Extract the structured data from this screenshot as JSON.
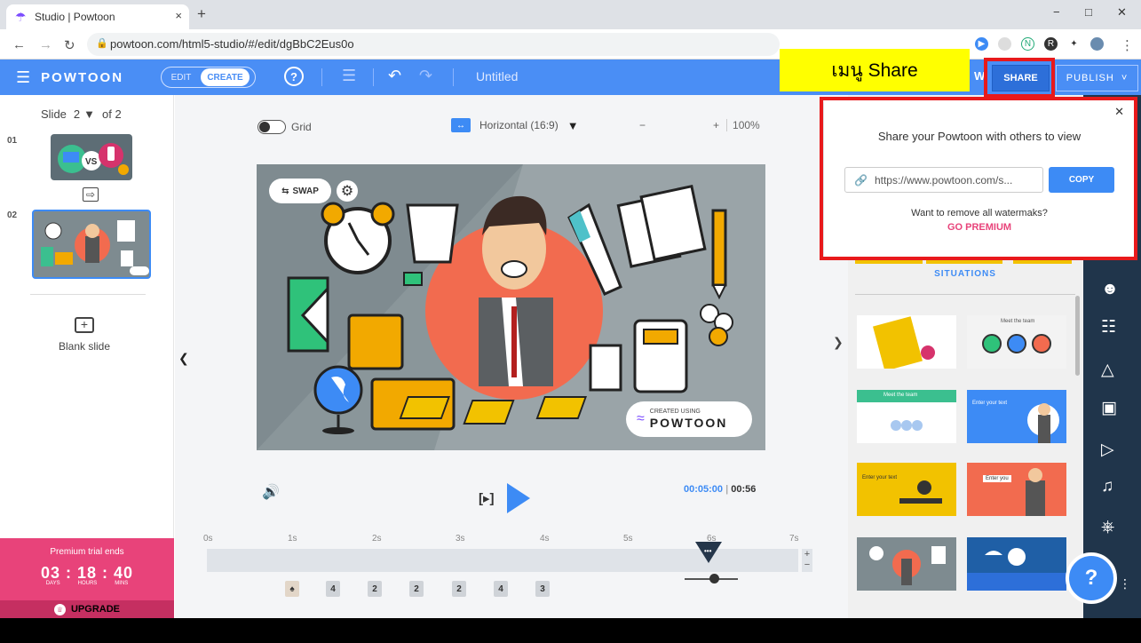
{
  "browser": {
    "tab_title": "Studio | Powtoon",
    "tab_close": "×",
    "new_tab": "+",
    "url": "powtoon.com/html5-studio/#/edit/dgBbC2Eus0o",
    "window_controls": [
      "−",
      "□",
      "✕"
    ]
  },
  "app": {
    "logo_text": "POWTOON",
    "mode_edit": "EDIT",
    "mode_create": "CREATE",
    "help_glyph": "?",
    "doc_title": "Untitled",
    "preview_partial": "W",
    "share_label": "SHARE",
    "publish_label": "PUBLISH"
  },
  "callout": {
    "text": "เมนู Share"
  },
  "slides": {
    "label_slide": "Slide",
    "current": "2",
    "of_label": "of 2",
    "items": [
      {
        "number": "01"
      },
      {
        "number": "02"
      }
    ],
    "blank_label": "Blank slide"
  },
  "premium": {
    "title": "Premium trial ends",
    "countdown": "03 : 18 : 40",
    "units": [
      "DAYS",
      "HOURS",
      "MINS"
    ],
    "upgrade": "UPGRADE"
  },
  "canvas_toolbar": {
    "grid_label": "Grid",
    "ratio_label": "Horizontal (16:9)",
    "zoom_minus": "−",
    "zoom_plus": "+",
    "zoom_value": "100%"
  },
  "scene": {
    "swap_label": "SWAP",
    "watermark_small": "CREATED USING",
    "watermark_brand": "POWTOON"
  },
  "player": {
    "current_time": "00:05:00",
    "separator": "|",
    "total_time": "00:56"
  },
  "timeline": {
    "ticks": [
      "0s",
      "1s",
      "2s",
      "3s",
      "4s",
      "5s",
      "6s",
      "7s"
    ],
    "layers": [
      "4",
      "2",
      "2",
      "2",
      "4",
      "3"
    ]
  },
  "library": {
    "category": "SITUATIONS",
    "items": [
      {
        "caption": ""
      },
      {
        "caption": "Meet the team"
      },
      {
        "caption": "Meet the team"
      },
      {
        "caption": "Enter your text"
      },
      {
        "caption": "Enter your text"
      },
      {
        "caption": "Enter you"
      },
      {
        "caption": ""
      },
      {
        "caption": ""
      }
    ]
  },
  "share_popover": {
    "title": "Share your Powtoon with others to view",
    "link": "https://www.powtoon.com/s...",
    "copy_label": "COPY",
    "remove_text": "Want to remove all watermaks?",
    "premium_link": "GO PREMIUM"
  },
  "colors": {
    "header": "#4a8ef5",
    "accent": "#3d8bf5",
    "premium_pink": "#e8437a",
    "toolbar_dark": "#20354b",
    "highlight_red": "#e8191b",
    "callout_yellow": "#ffff00"
  }
}
